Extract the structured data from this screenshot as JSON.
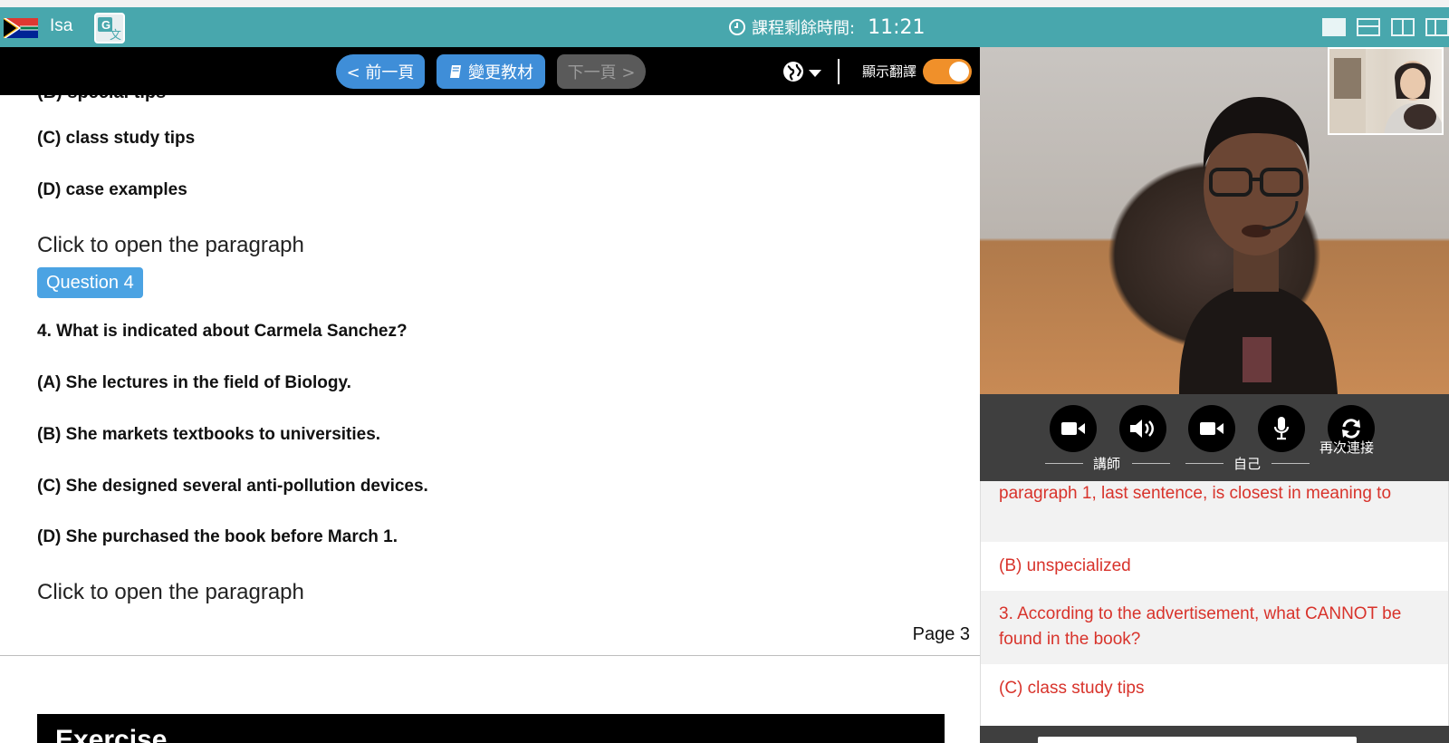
{
  "topbar": {
    "username": "Isa",
    "timer_label": "課程剩餘時間:",
    "timer_value": "11:21",
    "colors": {
      "bar": "#48a7ad"
    }
  },
  "toolbar": {
    "prev_label": "< 前一頁",
    "change_label": "變更教材",
    "next_label": "下一頁 >",
    "translation_label": "顯示翻譯",
    "translation_on": true
  },
  "content": {
    "options_prev": [
      {
        "text": "(C) class study tips"
      },
      {
        "text": "(D) case examples"
      }
    ],
    "open_paragraph_1": "Click to open the paragraph",
    "question_badge": "Question 4",
    "question": "4. What is indicated about Carmela Sanchez?",
    "options": [
      {
        "text": "(A) She lectures in the field of Biology."
      },
      {
        "text": "(B) She markets textbooks to universities."
      },
      {
        "text": "(C) She designed several anti-pollution devices."
      },
      {
        "text": "(D) She purchased the book before March 1."
      }
    ],
    "open_paragraph_2": "Click to open the paragraph",
    "page_number": "Page 3",
    "exercise_title": "Exercise"
  },
  "controls": {
    "teacher_label": "講師",
    "self_label": "自己",
    "reconnect_label": "再次連接"
  },
  "transcript": [
    {
      "text": "paragraph 1, last sentence, is closest in meaning to"
    },
    {
      "text": "(B) unspecialized"
    },
    {
      "text": "3. According to the advertisement, what CANNOT be found in the book?"
    },
    {
      "text": "(C) class study tips"
    }
  ]
}
